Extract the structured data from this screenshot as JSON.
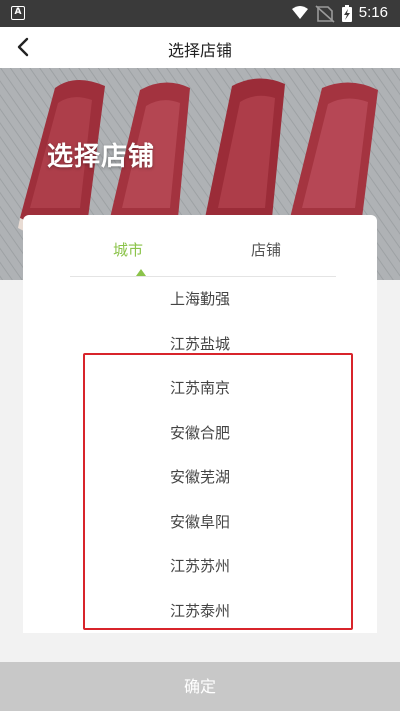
{
  "status_bar": {
    "app_icon_letter": "A",
    "time": "5:16"
  },
  "header": {
    "back_icon": "chevron-left-icon",
    "title": "选择店铺"
  },
  "hero": {
    "text": "选择店铺"
  },
  "tabs": [
    {
      "label": "城市",
      "active": true
    },
    {
      "label": "店铺",
      "active": false
    }
  ],
  "cities": [
    "上海勤强",
    "江苏盐城",
    "江苏南京",
    "安徽合肥",
    "安徽芜湖",
    "安徽阜阳",
    "江苏苏州",
    "江苏泰州"
  ],
  "confirm_label": "确定",
  "colors": {
    "accent": "#8bc34a",
    "annotation_box": "#d8242b",
    "button_disabled": "#c8c8c8"
  }
}
